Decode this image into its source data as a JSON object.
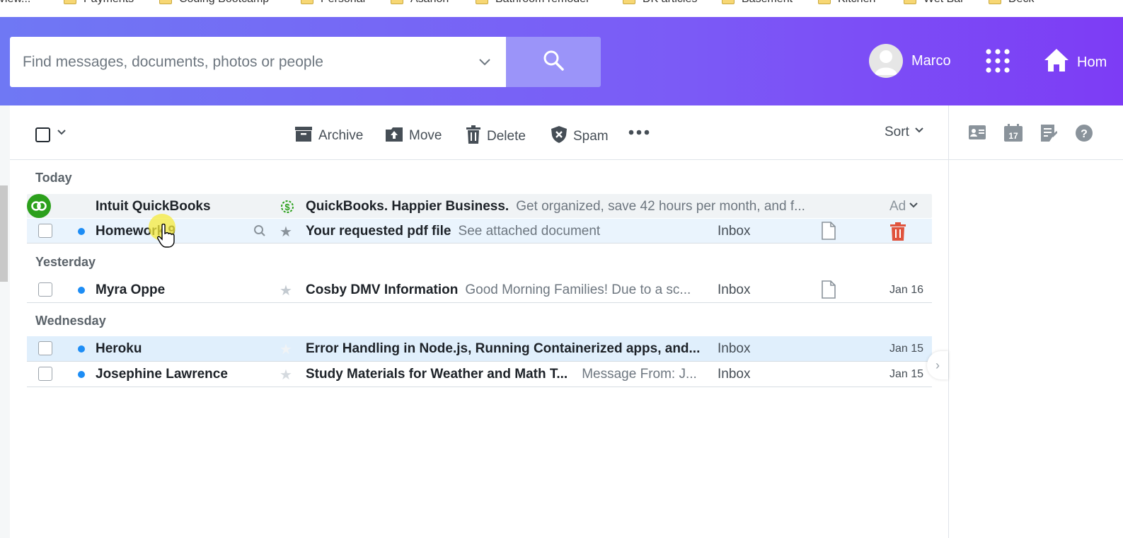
{
  "bookmarks": [
    {
      "label": "eview..."
    },
    {
      "label": "Payments"
    },
    {
      "label": "Coding Bootcamp"
    },
    {
      "label": "Personal"
    },
    {
      "label": "Asanon"
    },
    {
      "label": "Bathroom remodel"
    },
    {
      "label": "DK articles"
    },
    {
      "label": "Basement"
    },
    {
      "label": "Kitchen"
    },
    {
      "label": "Wet Bar"
    },
    {
      "label": "Deck"
    }
  ],
  "search": {
    "placeholder": "Find messages, documents, photos or people"
  },
  "user": {
    "name": "Marco"
  },
  "nav": {
    "home_label": "Hom"
  },
  "toolbar": {
    "archive": "Archive",
    "move": "Move",
    "delete": "Delete",
    "spam": "Spam",
    "sort": "Sort"
  },
  "right_panel": {
    "calendar_day": "17"
  },
  "sections": {
    "today": "Today",
    "yesterday": "Yesterday",
    "wednesday": "Wednesday"
  },
  "ad": {
    "sender": "Intuit QuickBooks",
    "subject": "QuickBooks. Happier Business.",
    "preview": "Get organized, save 42 hours per month, and f...",
    "label": "Ad"
  },
  "messages": [
    {
      "sender": "Homework 9",
      "subject": "Your requested pdf file",
      "preview": "See attached document",
      "folder": "Inbox",
      "date": ""
    },
    {
      "sender": "Myra Oppe",
      "subject": "Cosby DMV Information",
      "preview": "Good Morning Families! Due to a sc...",
      "folder": "Inbox",
      "date": "Jan 16"
    },
    {
      "sender": "Heroku",
      "subject": "Error Handling in Node.js, Running Containerized apps, and...",
      "preview": "",
      "folder": "Inbox",
      "date": "Jan 15"
    },
    {
      "sender": "Josephine Lawrence",
      "subject": "Study Materials for Weather and Math T...",
      "preview": "Message From: J...",
      "folder": "Inbox",
      "date": "Jan 15"
    }
  ],
  "colors": {
    "header_start": "#6f78f4",
    "header_end": "#7d3cf5",
    "unread_dot": "#1d8df5",
    "delete_red": "#e0533d",
    "quickbooks_green": "#2ca01c"
  }
}
